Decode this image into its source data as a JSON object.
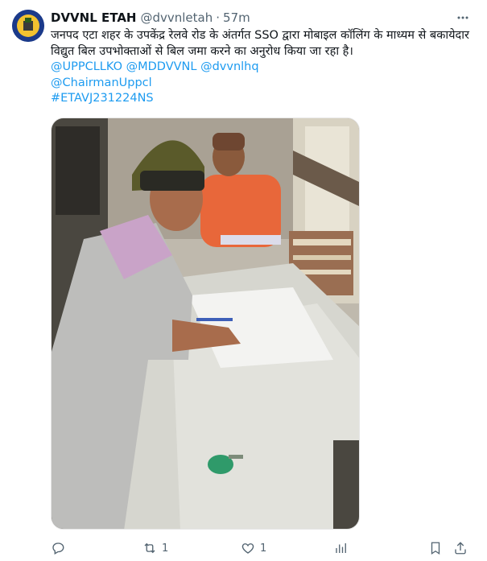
{
  "tweet": {
    "author_name": "DVVNL ETAH",
    "author_handle": "@dvvnletah",
    "separator": "·",
    "time": "57m",
    "text": "जनपद एटा शहर के उपकेंद्र रेलवे रोड के अंतर्गत SSO द्वारा मोबाइल कॉलिंग के माध्यम से बकायेदार विद्युत बिल उपभोक्ताओं से बिल जमा करने का अनुरोध किया जा रहा है।",
    "mentions_line": "@UPPCLLKO @MDDVVNL @dvvnlhq",
    "mention_2": "@ChairmanUppcl",
    "hashtag": "#ETAVJ231224NS",
    "photo_alt": "photo"
  },
  "actions": {
    "reply_icon": "reply-icon",
    "repost_icon": "repost-icon",
    "repost_count": "1",
    "like_icon": "like-icon",
    "like_count": "1",
    "views_icon": "views-icon",
    "bookmark_icon": "bookmark-icon",
    "share_icon": "share-icon"
  },
  "colors": {
    "link": "#1d9bf0",
    "secondary_text": "#536471",
    "primary_text": "#0f1419"
  }
}
